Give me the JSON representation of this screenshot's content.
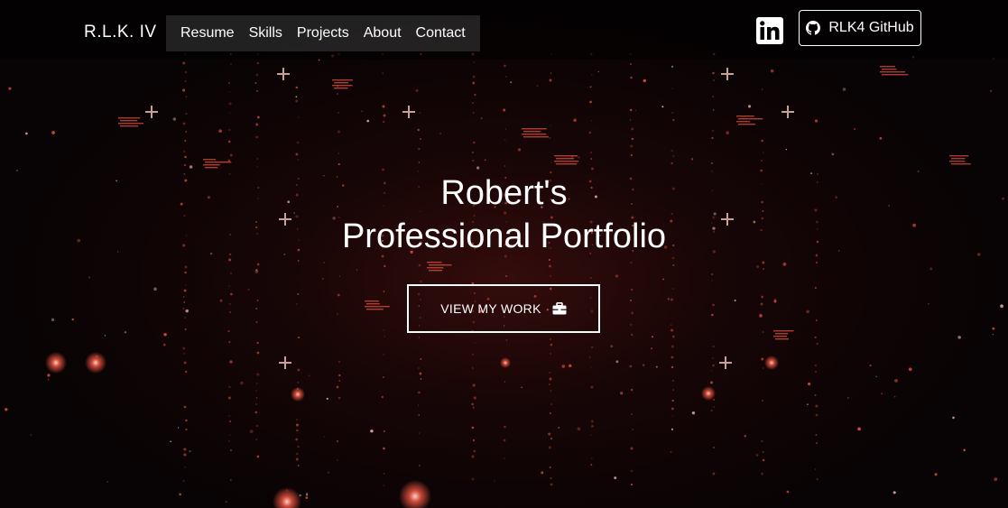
{
  "header": {
    "brand": "R.L.K. IV",
    "nav": [
      {
        "label": "Resume"
      },
      {
        "label": "Skills"
      },
      {
        "label": "Projects"
      },
      {
        "label": "About"
      },
      {
        "label": "Contact"
      }
    ],
    "linkedin_icon": "linkedin-icon",
    "github_button": {
      "label": "RLK4 GitHub",
      "icon": "github-icon"
    }
  },
  "hero": {
    "title_line1": "Robert's",
    "title_line2": "Professional Portfolio",
    "cta": {
      "label": "VIEW MY WORK",
      "icon": "briefcase-icon"
    }
  },
  "colors": {
    "background": "#070304",
    "accent_red": "#e0503e",
    "text": "#ffffff"
  }
}
